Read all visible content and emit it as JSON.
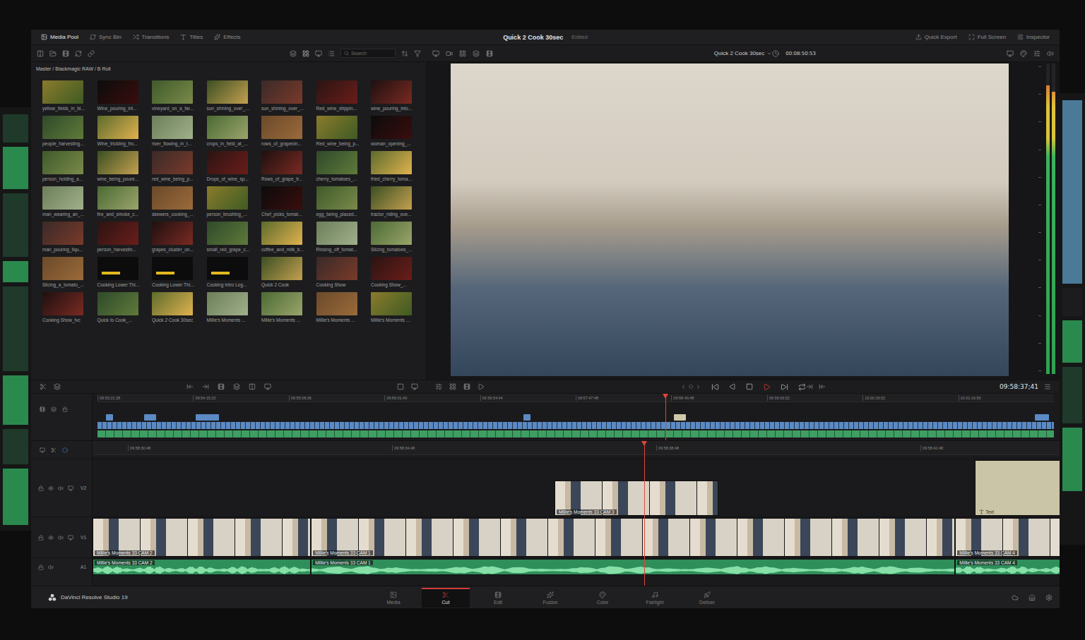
{
  "toolbar": {
    "tabs": [
      {
        "label": "Media Pool",
        "selected": true
      },
      {
        "label": "Sync Bin",
        "selected": false
      },
      {
        "label": "Transitions",
        "selected": false
      },
      {
        "label": "Titles",
        "selected": false
      },
      {
        "label": "Effects",
        "selected": false
      }
    ],
    "project": "Quick 2 Cook 30sec",
    "status": "Edited",
    "actions": [
      "Quick Export",
      "Full Screen",
      "Inspector"
    ]
  },
  "media_pool": {
    "search_placeholder": "Search",
    "path": "Master / Blackmagic RAW / B Roll",
    "clips": [
      {
        "label": "yellow_fields_in_bl...",
        "kind": "video"
      },
      {
        "label": "Wine_pouring_int...",
        "kind": "video"
      },
      {
        "label": "vineyard_on_a_far...",
        "kind": "video"
      },
      {
        "label": "sun_shining_over_...",
        "kind": "video"
      },
      {
        "label": "sun_shining_over_...",
        "kind": "video"
      },
      {
        "label": "Red_wine_drippin...",
        "kind": "video"
      },
      {
        "label": "wine_pouring_into...",
        "kind": "video"
      },
      {
        "label": "people_harvesting...",
        "kind": "video"
      },
      {
        "label": "Wine_trickling_fro...",
        "kind": "video"
      },
      {
        "label": "river_flowing_in_t...",
        "kind": "video"
      },
      {
        "label": "crops_in_field_at_...",
        "kind": "video"
      },
      {
        "label": "rows_of_grapevin...",
        "kind": "video"
      },
      {
        "label": "Red_wine_being_p...",
        "kind": "video"
      },
      {
        "label": "woman_opening_...",
        "kind": "video"
      },
      {
        "label": "person_holding_a...",
        "kind": "video"
      },
      {
        "label": "wine_being_poure...",
        "kind": "video"
      },
      {
        "label": "red_wine_being_p...",
        "kind": "video"
      },
      {
        "label": "Drops_of_wine_sp...",
        "kind": "video"
      },
      {
        "label": "Rows_of_grape_tr...",
        "kind": "video"
      },
      {
        "label": "cherry_tomatoes_...",
        "kind": "video"
      },
      {
        "label": "fried_cherry_toma...",
        "kind": "video"
      },
      {
        "label": "man_wearing_an_...",
        "kind": "video"
      },
      {
        "label": "fire_and_smoke_c...",
        "kind": "video"
      },
      {
        "label": "skewers_cooking_...",
        "kind": "video"
      },
      {
        "label": "person_brushing_...",
        "kind": "video"
      },
      {
        "label": "Chef_picks_tomat...",
        "kind": "video"
      },
      {
        "label": "egg_being_placed...",
        "kind": "video"
      },
      {
        "label": "tractor_riding_ove...",
        "kind": "video"
      },
      {
        "label": "man_pouring_liqu...",
        "kind": "video"
      },
      {
        "label": "person_harvestin...",
        "kind": "video"
      },
      {
        "label": "grapes_cluster_on...",
        "kind": "video"
      },
      {
        "label": "small_red_grape_c...",
        "kind": "video"
      },
      {
        "label": "coffee_and_milk_b...",
        "kind": "video"
      },
      {
        "label": "Rinsing_off_tomat...",
        "kind": "video"
      },
      {
        "label": "Slicing_tomatoes_...",
        "kind": "video"
      },
      {
        "label": "Slicing_a_tomato_...",
        "kind": "video"
      },
      {
        "label": "Cooking Lower Thi...",
        "kind": "title"
      },
      {
        "label": "Cooking Lower Thi...",
        "kind": "title"
      },
      {
        "label": "Cooking Intro Log...",
        "kind": "title"
      },
      {
        "label": "Quick 2 Cook",
        "kind": "video"
      },
      {
        "label": "Cooking Show",
        "kind": "video"
      },
      {
        "label": "Cooking Show_...",
        "kind": "video"
      },
      {
        "label": "Cooking Show_tvc",
        "kind": "video"
      },
      {
        "label": "Quick to Cook_...",
        "kind": "video"
      },
      {
        "label": "Quick 2 Cook 30sec",
        "kind": "video"
      },
      {
        "label": "Millie's Moments ...",
        "kind": "video"
      },
      {
        "label": "Millie's Moments ...",
        "kind": "video"
      },
      {
        "label": "Millie's Moments ...",
        "kind": "video"
      },
      {
        "label": "Millie's Moments ...",
        "kind": "video"
      }
    ]
  },
  "viewer": {
    "clip": "Quick 2 Cook 30sec",
    "duration": "00:08:50:53",
    "timecode": "09:58:37;41",
    "meters": [
      {
        "level": 0.93
      },
      {
        "level": 0.91
      }
    ]
  },
  "overview": {
    "ticks": [
      "09:53:22;28",
      "09:54:15;32",
      "09:55:08;36",
      "09:56:01;40",
      "09:56:54;44",
      "09:57:47;48",
      "09:58:40;48",
      "09:59:33;52",
      "10:00:26;52",
      "10:01:19;56"
    ],
    "playhead": 0.594,
    "markers": [
      {
        "start": 0.009,
        "end": 0.016,
        "color": "#5b8ac4"
      },
      {
        "start": 0.049,
        "end": 0.061,
        "color": "#5b8ac4"
      },
      {
        "start": 0.103,
        "end": 0.127,
        "color": "#5b8ac4"
      },
      {
        "start": 0.445,
        "end": 0.453,
        "color": "#5b8ac4"
      },
      {
        "start": 0.603,
        "end": 0.615,
        "color": "#cfc8a6"
      },
      {
        "start": 0.98,
        "end": 0.995,
        "color": "#5b8ac4"
      }
    ]
  },
  "timeline": {
    "ticks": [
      "09:58:30;48",
      "09:58:34;48",
      "09:58:38;48",
      "09:58:42;48"
    ],
    "playhead": 0.505,
    "tracks": [
      {
        "name": "V2",
        "kind": "video",
        "clips": [
          {
            "label": "Millie's Moments 33 CAM 3",
            "kind": "video",
            "start": 0.423,
            "end": 0.573
          },
          {
            "label": "Text",
            "kind": "title",
            "start": 0.808,
            "end": 1.0
          }
        ]
      },
      {
        "name": "V1",
        "kind": "video",
        "clips": [
          {
            "label": "Millie's Moments 33 CAM 2",
            "kind": "video",
            "start": 0.0,
            "end": 0.2
          },
          {
            "label": "Millie's Moments 33 CAM 1",
            "kind": "video",
            "start": 0.2,
            "end": 0.79
          },
          {
            "label": "Millie's Moments 33 CAM 4",
            "kind": "video",
            "start": 0.79,
            "end": 1.0
          }
        ]
      },
      {
        "name": "A1",
        "kind": "audio",
        "clips": [
          {
            "label": "Millie's Moments 33 CAM 2",
            "kind": "audio",
            "start": 0.0,
            "end": 0.2
          },
          {
            "label": "Millie's Moments 33 CAM 1",
            "kind": "audio",
            "start": 0.2,
            "end": 0.79
          },
          {
            "label": "Millie's Moments 33 CAM 4",
            "kind": "audio",
            "start": 0.79,
            "end": 1.0
          }
        ]
      }
    ]
  },
  "pages": [
    {
      "label": "Media",
      "selected": false
    },
    {
      "label": "Cut",
      "selected": true
    },
    {
      "label": "Edit",
      "selected": false
    },
    {
      "label": "Fusion",
      "selected": false
    },
    {
      "label": "Color",
      "selected": false
    },
    {
      "label": "Fairlight",
      "selected": false
    },
    {
      "label": "Deliver",
      "selected": false
    }
  ],
  "app": {
    "name": "DaVinci Resolve Studio 19"
  }
}
